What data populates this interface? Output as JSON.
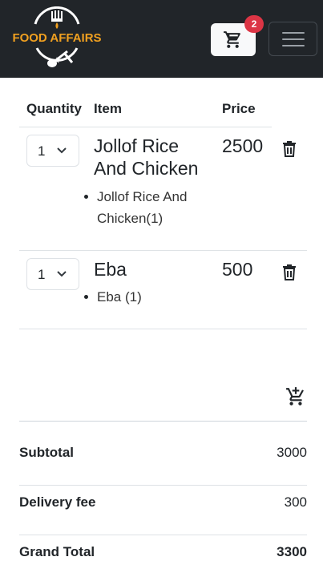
{
  "header": {
    "brand": "FOOD AFFAIRS",
    "cart_count": "2"
  },
  "cart": {
    "columns": [
      "Quantity",
      "Item",
      "Price"
    ],
    "items": [
      {
        "qty": "1",
        "name": "Jollof Rice And Chicken",
        "price": "2500",
        "details": [
          "Jollof Rice And Chicken(1)"
        ]
      },
      {
        "qty": "1",
        "name": "Eba",
        "price": "500",
        "details": [
          "Eba (1)"
        ]
      }
    ]
  },
  "summary": {
    "subtotal_label": "Subtotal",
    "subtotal_value": "3000",
    "delivery_label": "Delivery fee",
    "delivery_value": "300",
    "grand_label": "Grand Total",
    "grand_value": "3300"
  },
  "colors": {
    "navbar": "#212529",
    "brand": "#f0a020",
    "badge": "#dc3545"
  }
}
